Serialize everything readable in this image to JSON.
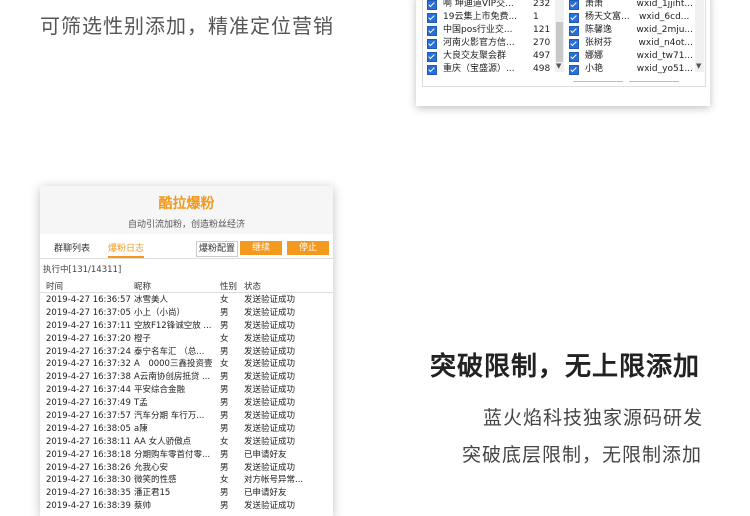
{
  "top_heading": "可筛选性别添加，精准定位营销",
  "group_window": {
    "groups": [
      {
        "name": "啊 坤迪道VIP交...",
        "count": "232"
      },
      {
        "name": "19云集上市免费...",
        "count": "1"
      },
      {
        "name": "中国pos行业交...",
        "count": "121"
      },
      {
        "name": "河南火影官方信...",
        "count": "270"
      },
      {
        "name": "大良交友聚会群",
        "count": "497"
      },
      {
        "name": "重庆（宝盛源）...",
        "count": "498"
      }
    ],
    "members": [
      {
        "name": "萧萧",
        "wxid": "wxid_1jjiht..."
      },
      {
        "name": "杨天文富...",
        "wxid": "wxid_6cd..."
      },
      {
        "name": "陈馨逸",
        "wxid": "wxid_2mju..."
      },
      {
        "name": "张树芬",
        "wxid": "wxid_n4ot..."
      },
      {
        "name": "娜娜",
        "wxid": "wxid_tw71..."
      },
      {
        "name": "小艳",
        "wxid": "wxid_yo51..."
      }
    ]
  },
  "right_text": {
    "heading": "突破限制，无上限添加",
    "line1": "蓝火焰科技独家源码研发",
    "line2": "突破底层限制，无限制添加"
  },
  "app": {
    "title": "酷拉爆粉",
    "subtitle": "自动引流加粉，创造粉丝经济",
    "tabs": [
      "群聊列表",
      "爆粉日志"
    ],
    "active_tab": "爆粉日志",
    "config_button": "爆粉配置",
    "continue_button": "继续",
    "stop_button": "停止",
    "status": "执行中[131/14311]",
    "columns": [
      "时间",
      "昵称",
      "性别",
      "状态"
    ],
    "rows": [
      [
        "2019-4-27 16:36:57",
        "冰雪美人",
        "女",
        "发送验证成功"
      ],
      [
        "2019-4-27 16:37:05",
        "小上（小尚）",
        "男",
        "发送验证成功"
      ],
      [
        "2019-4-27 16:37:11",
        "空放F12锋诚空放 ...",
        "男",
        "发送验证成功"
      ],
      [
        "2019-4-27 16:37:20",
        "橙子",
        "女",
        "发送验证成功"
      ],
      [
        "2019-4-27 16:37:24",
        "泰宁名车汇 （总...",
        "男",
        "发送验证成功"
      ],
      [
        "2019-4-27 16:37:32",
        "A　0000三鑫投资壹",
        "女",
        "发送验证成功"
      ],
      [
        "2019-4-27 16:37:38",
        "A云南协创房抵贷 ...",
        "男",
        "发送验证成功"
      ],
      [
        "2019-4-27 16:37:44",
        "平安综合金融",
        "男",
        "发送验证成功"
      ],
      [
        "2019-4-27 16:37:49",
        "T孟",
        "男",
        "发送验证成功"
      ],
      [
        "2019-4-27 16:37:57",
        "汽车分期 车行万...",
        "男",
        "发送验证成功"
      ],
      [
        "2019-4-27 16:38:05",
        "a陳",
        "男",
        "发送验证成功"
      ],
      [
        "2019-4-27 16:38:11",
        "AA 女人骄傲点",
        "女",
        "发送验证成功"
      ],
      [
        "2019-4-27 16:38:18",
        "分期购车零首付零...",
        "男",
        "已申请好友"
      ],
      [
        "2019-4-27 16:38:26",
        "允我心安",
        "男",
        "发送验证成功"
      ],
      [
        "2019-4-27 16:38:30",
        "微笑的性感",
        "女",
        "对方帐号异常..."
      ],
      [
        "2019-4-27 16:38:35",
        "潘正君15",
        "男",
        "已申请好友"
      ],
      [
        "2019-4-27 16:38:39",
        "蔡帅",
        "男",
        "发送验证成功"
      ]
    ]
  },
  "colors": {
    "accent": "#f39a1e",
    "checkbox": "#2a6fd6"
  }
}
